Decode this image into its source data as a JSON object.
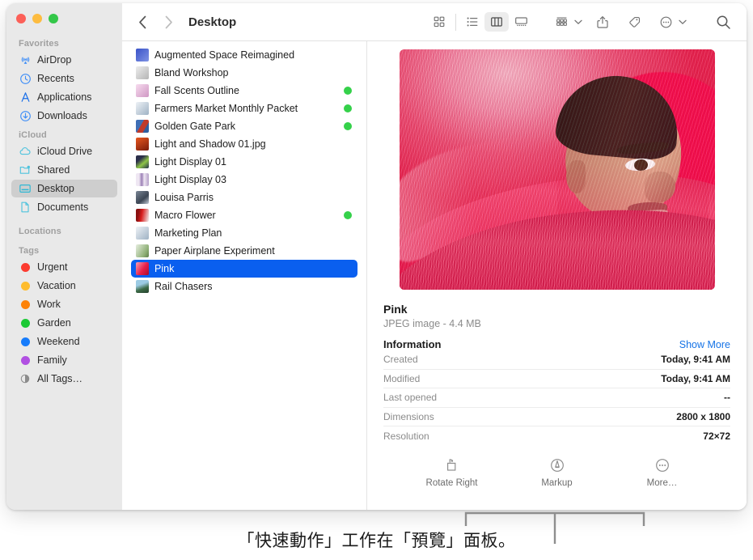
{
  "window": {
    "traffic_lights": [
      {
        "name": "close",
        "color": "#fc6058"
      },
      {
        "name": "minimize",
        "color": "#fdbc40"
      },
      {
        "name": "maximize",
        "color": "#34c749"
      }
    ]
  },
  "sidebar": {
    "sections": [
      {
        "header": "Favorites",
        "items": [
          {
            "label": "AirDrop",
            "icon": "airdrop-icon"
          },
          {
            "label": "Recents",
            "icon": "clock-icon"
          },
          {
            "label": "Applications",
            "icon": "applications-icon"
          },
          {
            "label": "Downloads",
            "icon": "downloads-icon"
          }
        ]
      },
      {
        "header": "iCloud",
        "items": [
          {
            "label": "iCloud Drive",
            "icon": "cloud-icon"
          },
          {
            "label": "Shared",
            "icon": "shared-folder-icon"
          },
          {
            "label": "Desktop",
            "icon": "desktop-icon",
            "selected": true
          },
          {
            "label": "Documents",
            "icon": "document-icon"
          }
        ]
      },
      {
        "header": "Locations",
        "items": []
      },
      {
        "header": "Tags",
        "items": [
          {
            "label": "Urgent",
            "icon": "tag-dot-icon",
            "color": "#fc3b30"
          },
          {
            "label": "Vacation",
            "icon": "tag-dot-icon",
            "color": "#febc2e"
          },
          {
            "label": "Work",
            "icon": "tag-dot-icon",
            "color": "#fd8208"
          },
          {
            "label": "Garden",
            "icon": "tag-dot-icon",
            "color": "#1bc935"
          },
          {
            "label": "Weekend",
            "icon": "tag-dot-icon",
            "color": "#177cfb"
          },
          {
            "label": "Family",
            "icon": "tag-dot-icon",
            "color": "#b150e2"
          },
          {
            "label": "All Tags…",
            "icon": "all-tags-icon"
          }
        ]
      }
    ]
  },
  "toolbar": {
    "back_icon": "chevron-left-icon",
    "forward_icon": "chevron-right-icon",
    "title": "Desktop",
    "view_modes": [
      {
        "name": "icon-view",
        "icon": "grid-icon",
        "active": false
      },
      {
        "name": "list-view",
        "icon": "list-icon",
        "active": false
      },
      {
        "name": "column-view",
        "icon": "columns-icon",
        "active": true
      },
      {
        "name": "gallery-view",
        "icon": "gallery-icon",
        "active": false
      }
    ],
    "actions": [
      {
        "name": "group-by-button",
        "icon": "group-icon",
        "chevron": true
      },
      {
        "name": "share-button",
        "icon": "share-icon",
        "chevron": false
      },
      {
        "name": "tag-button",
        "icon": "tag-icon",
        "chevron": false
      },
      {
        "name": "more-actions-button",
        "icon": "ellipsis-circle-icon",
        "chevron": true
      }
    ],
    "search_icon": "search-icon"
  },
  "file_list": {
    "items": [
      {
        "name": "Augmented Space Reimagined",
        "tag": "",
        "icon_colors": [
          "#3a53c8",
          "#7f93e4"
        ]
      },
      {
        "name": "Bland Workshop",
        "tag": "",
        "icon_colors": [
          "#d9d9d9",
          "#a8a8a8"
        ]
      },
      {
        "name": "Fall Scents Outline",
        "tag": "#35d14a",
        "icon_colors": [
          "#f2d6ea",
          "#d89ec9"
        ]
      },
      {
        "name": "Farmers Market Monthly Packet",
        "tag": "#35d14a",
        "icon_colors": [
          "#e8edf2",
          "#8fa4b8"
        ]
      },
      {
        "name": "Golden Gate Park",
        "tag": "#35d14a",
        "icon_colors": [
          "#3f6fb5",
          "#c03a2b"
        ]
      },
      {
        "name": "Light and Shadow 01.jpg",
        "tag": "",
        "icon_colors": [
          "#d5471f",
          "#7a1c0b"
        ]
      },
      {
        "name": "Light Display 01",
        "tag": "",
        "icon_colors": [
          "#2b2f4a",
          "#8fc648"
        ]
      },
      {
        "name": "Light Display 03",
        "tag": "",
        "icon_colors": [
          "#efe7f3",
          "#9a7fb5"
        ]
      },
      {
        "name": "Louisa Parris",
        "tag": "",
        "icon_colors": [
          "#556070",
          "#aab4c0"
        ]
      },
      {
        "name": "Macro Flower",
        "tag": "#35d14a",
        "icon_colors": [
          "#b81414",
          "#e8e8e8"
        ]
      },
      {
        "name": "Marketing Plan",
        "tag": "",
        "icon_colors": [
          "#e8edf2",
          "#8fa4b8"
        ]
      },
      {
        "name": "Paper Airplane Experiment",
        "tag": "",
        "icon_colors": [
          "#dfe6d8",
          "#8fb077"
        ]
      },
      {
        "name": "Pink",
        "tag": "",
        "selected": true,
        "icon_colors": [
          "#e81f4a",
          "#f5a0b5"
        ]
      },
      {
        "name": "Rail Chasers",
        "tag": "",
        "icon_colors": [
          "#6fa8c9",
          "#3d6b47"
        ]
      }
    ]
  },
  "preview": {
    "file_name": "Pink",
    "file_kind": "JPEG image - 4.4 MB",
    "section_title": "Information",
    "show_more_label": "Show More",
    "info_rows": [
      {
        "key": "Created",
        "value": "Today, 9:41 AM"
      },
      {
        "key": "Modified",
        "value": "Today, 9:41 AM"
      },
      {
        "key": "Last opened",
        "value": "--"
      },
      {
        "key": "Dimensions",
        "value": "2800 x 1800"
      },
      {
        "key": "Resolution",
        "value": "72×72"
      }
    ],
    "quick_actions": [
      {
        "label": "Rotate Right",
        "icon": "rotate-right-icon"
      },
      {
        "label": "Markup",
        "icon": "markup-icon"
      },
      {
        "label": "More…",
        "icon": "ellipsis-circle-icon"
      }
    ]
  },
  "callout": {
    "caption": "「快速動作」工作在「預覽」面板。",
    "bracket_color": "#8e8e8e"
  }
}
